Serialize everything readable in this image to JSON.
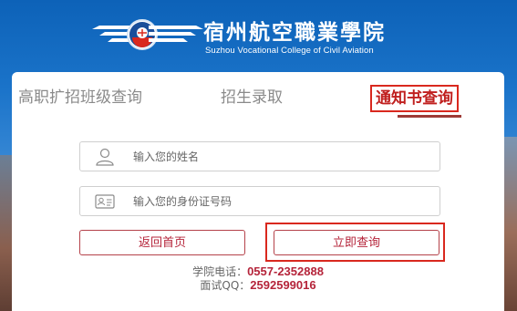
{
  "header": {
    "school_name_cn": "宿州航空職業學院",
    "school_name_en": "Suzhou Vocational College of Civil Aviation",
    "logo_icon": "aviation-emblem-icon"
  },
  "tabs": [
    {
      "label": "高职扩招班级查询",
      "active": false
    },
    {
      "label": "招生录取",
      "active": false
    },
    {
      "label": "通知书查询",
      "active": true
    }
  ],
  "form": {
    "name_placeholder": "输入您的姓名",
    "name_value": "",
    "name_icon": "user-icon",
    "id_placeholder": "输入您的身份证号码",
    "id_value": "",
    "id_icon": "id-card-icon"
  },
  "buttons": {
    "back_label": "返回首页",
    "query_label": "立即查询"
  },
  "contact": {
    "phone_label": "学院电话：",
    "phone_value": "0557-2352888",
    "qq_label": "面试QQ：",
    "qq_value": "2592599016"
  },
  "colors": {
    "header_blue": "#0d62b8",
    "accent_red": "#b5243a",
    "highlight_red": "#d9281e"
  }
}
